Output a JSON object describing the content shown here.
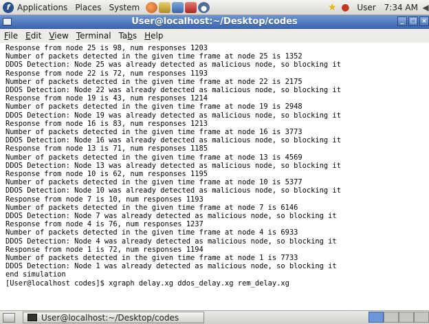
{
  "top_panel": {
    "menus": [
      "Applications",
      "Places",
      "System"
    ],
    "launchers": [
      "firefox-icon",
      "evolution-icon",
      "network-icon",
      "redhat-icon",
      "helper-icon"
    ],
    "tray": {
      "user": "User",
      "clock": "7:34 AM"
    }
  },
  "window": {
    "title": "User@localhost:~/Desktop/codes",
    "menubar": {
      "file": {
        "mn": "F",
        "rest": "ile"
      },
      "edit": {
        "mn": "E",
        "rest": "dit"
      },
      "view": {
        "mn": "V",
        "rest": "iew"
      },
      "terminal": {
        "mn": "T",
        "rest": "erminal"
      },
      "tabs": {
        "pre": "Ta",
        "mn": "b",
        "rest": "s"
      },
      "help": {
        "mn": "H",
        "rest": "elp"
      }
    }
  },
  "terminal": {
    "lines": [
      "Response from node 25 is 98, num responses 1203",
      "Number of packets detected in the given time frame at node 25 is 1352",
      "DDOS Detection: Node 25 was already detected as malicious node, so blocking it",
      "Response from node 22 is 72, num responses 1193",
      "Number of packets detected in the given time frame at node 22 is 2175",
      "DDOS Detection: Node 22 was already detected as malicious node, so blocking it",
      "Response from node 19 is 43, num responses 1214",
      "Number of packets detected in the given time frame at node 19 is 2948",
      "DDOS Detection: Node 19 was already detected as malicious node, so blocking it",
      "Response from node 16 is 83, num responses 1213",
      "Number of packets detected in the given time frame at node 16 is 3773",
      "DDOS Detection: Node 16 was already detected as malicious node, so blocking it",
      "Response from node 13 is 71, num responses 1185",
      "Number of packets detected in the given time frame at node 13 is 4569",
      "DDOS Detection: Node 13 was already detected as malicious node, so blocking it",
      "Response from node 10 is 62, num responses 1195",
      "Number of packets detected in the given time frame at node 10 is 5377",
      "DDOS Detection: Node 10 was already detected as malicious node, so blocking it",
      "Response from node 7 is 10, num responses 1193",
      "Number of packets detected in the given time frame at node 7 is 6146",
      "DDOS Detection: Node 7 was already detected as malicious node, so blocking it",
      "Response from node 4 is 76, num responses 1237",
      "Number of packets detected in the given time frame at node 4 is 6933",
      "DDOS Detection: Node 4 was already detected as malicious node, so blocking it",
      "Response from node 1 is 72, num responses 1194",
      "Number of packets detected in the given time frame at node 1 is 7733",
      "DDOS Detection: Node 1 was already detected as malicious node, so blocking it",
      "end simulation",
      "[User@localhost codes]$ xgraph delay.xg ddos_delay.xg rem_delay.xg"
    ]
  },
  "bottom_panel": {
    "task_label": "User@localhost:~/Desktop/codes"
  }
}
